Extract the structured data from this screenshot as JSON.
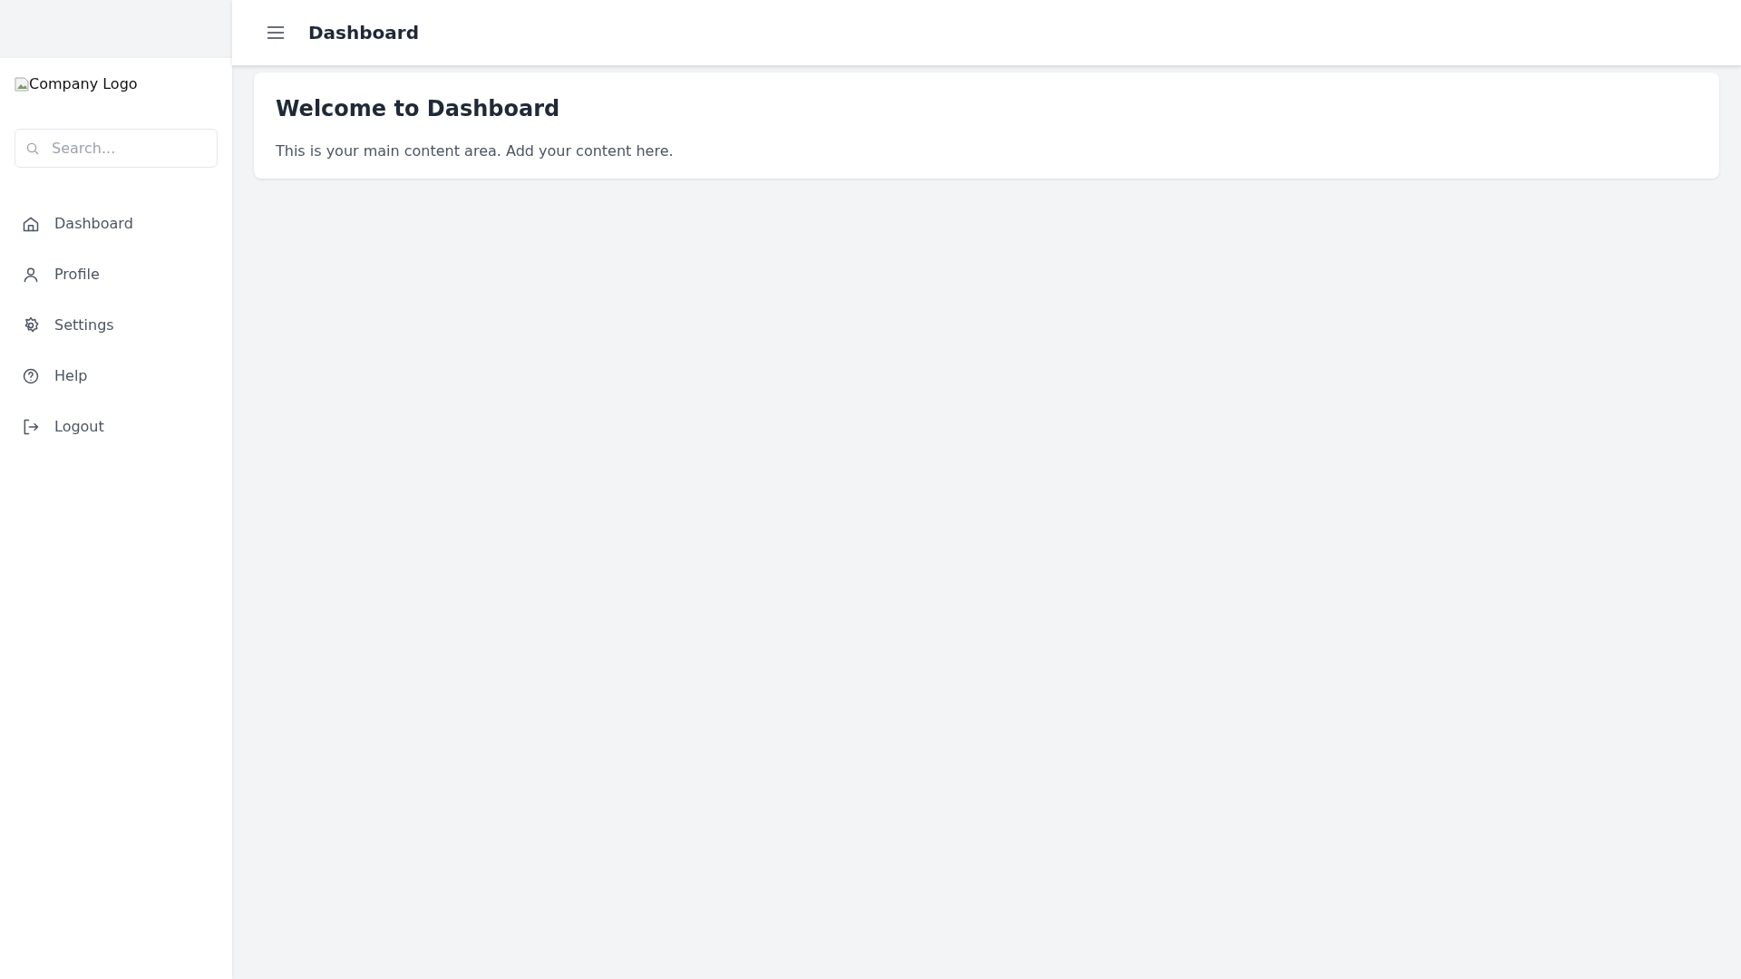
{
  "sidebar": {
    "logo_text": "Company Logo",
    "search": {
      "placeholder": "Search..."
    },
    "items": [
      {
        "kind": "home",
        "label": "Dashboard"
      },
      {
        "kind": "user",
        "label": "Profile"
      },
      {
        "kind": "gear",
        "label": "Settings"
      },
      {
        "kind": "help",
        "label": "Help"
      },
      {
        "kind": "logout",
        "label": "Logout"
      }
    ]
  },
  "header": {
    "title": "Dashboard"
  },
  "card": {
    "title": "Welcome to Dashboard",
    "text": "This is your main content area. Add your content here."
  }
}
